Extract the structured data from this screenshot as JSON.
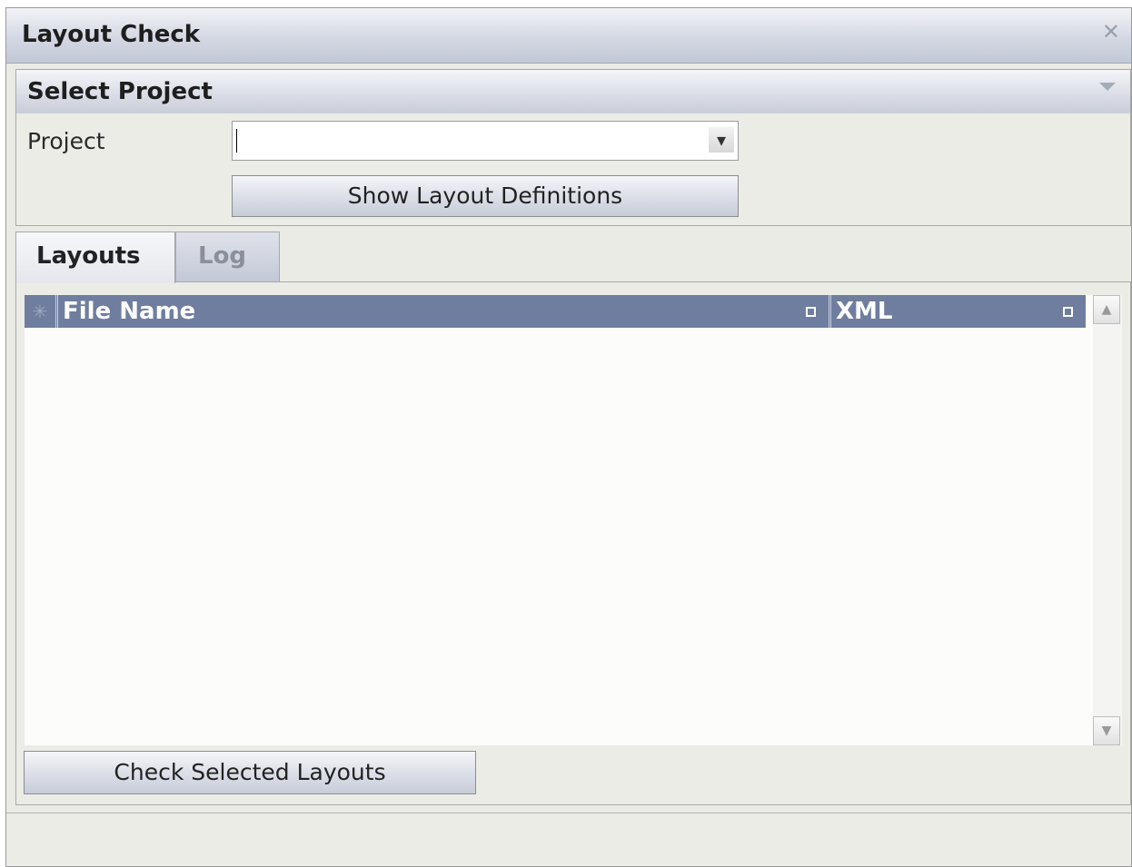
{
  "window": {
    "title": "Layout Check",
    "close_icon": "✕"
  },
  "select_project": {
    "header": "Select Project",
    "project_label": "Project",
    "project_value": "",
    "dropdown_icon": "▾",
    "show_button": "Show Layout Definitions"
  },
  "tabs": [
    {
      "label": "Layouts",
      "active": true
    },
    {
      "label": "Log",
      "active": false
    }
  ],
  "grid": {
    "select_marker": "✳",
    "columns": [
      {
        "label": "File Name"
      },
      {
        "label": "XML"
      }
    ],
    "rows": []
  },
  "scroll": {
    "up_icon": "▲",
    "down_icon": "▼"
  },
  "check_button": "Check Selected Layouts",
  "colors": {
    "grid_header": "#6f7d9f",
    "panel_bg": "#ecece7"
  }
}
